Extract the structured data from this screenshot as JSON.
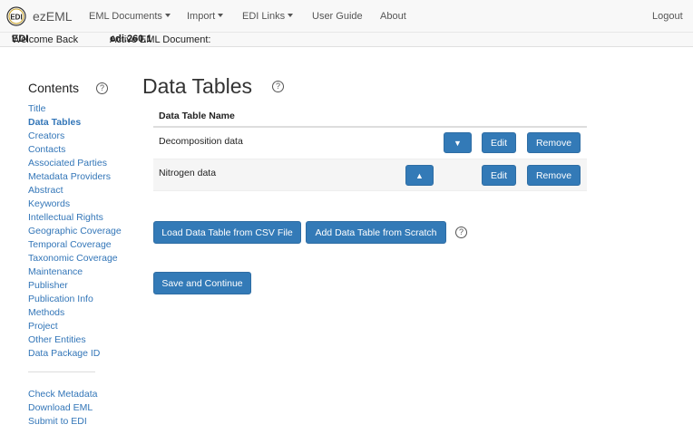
{
  "navbar": {
    "brand": "ezEML",
    "menus": [
      {
        "label": "EML Documents",
        "has_caret": true
      },
      {
        "label": "Import",
        "has_caret": true
      },
      {
        "label": "EDI Links",
        "has_caret": true
      },
      {
        "label": "User Guide",
        "has_caret": false
      },
      {
        "label": "About",
        "has_caret": false
      }
    ],
    "logout": "Logout"
  },
  "subbar": {
    "welcome_prefix": "Welcome Back",
    "user": "EDI",
    "active_prefix": "Active EML Document:",
    "document": "edi.260.1"
  },
  "sidebar": {
    "title": "Contents",
    "help": "?",
    "items": [
      "Title",
      "Data Tables",
      "Creators",
      "Contacts",
      "Associated Parties",
      "Metadata Providers",
      "Abstract",
      "Keywords",
      "Intellectual Rights",
      "Geographic Coverage",
      "Temporal Coverage",
      "Taxonomic Coverage",
      "Maintenance",
      "Publisher",
      "Publication Info",
      "Methods",
      "Project",
      "Other Entities",
      "Data Package ID"
    ],
    "active_index": 1,
    "footer_items": [
      "Check Metadata",
      "Download EML",
      "Submit to EDI"
    ]
  },
  "main": {
    "title": "Data Tables",
    "help": "?",
    "table": {
      "header": "Data Table Name",
      "rows": [
        {
          "name": "Decomposition data",
          "move": "▼",
          "edit": "Edit",
          "remove": "Remove"
        },
        {
          "name": "Nitrogen data",
          "move": "▲",
          "edit": "Edit",
          "remove": "Remove"
        }
      ]
    },
    "load_csv_button": "Load Data Table from CSV File",
    "add_scratch_button": "Add Data Table from Scratch",
    "add_help": "?",
    "save_button": "Save and Continue"
  },
  "colors": {
    "primary": "#337ab7",
    "link": "#3376b8",
    "navbar_bg": "#f8f8f8"
  }
}
